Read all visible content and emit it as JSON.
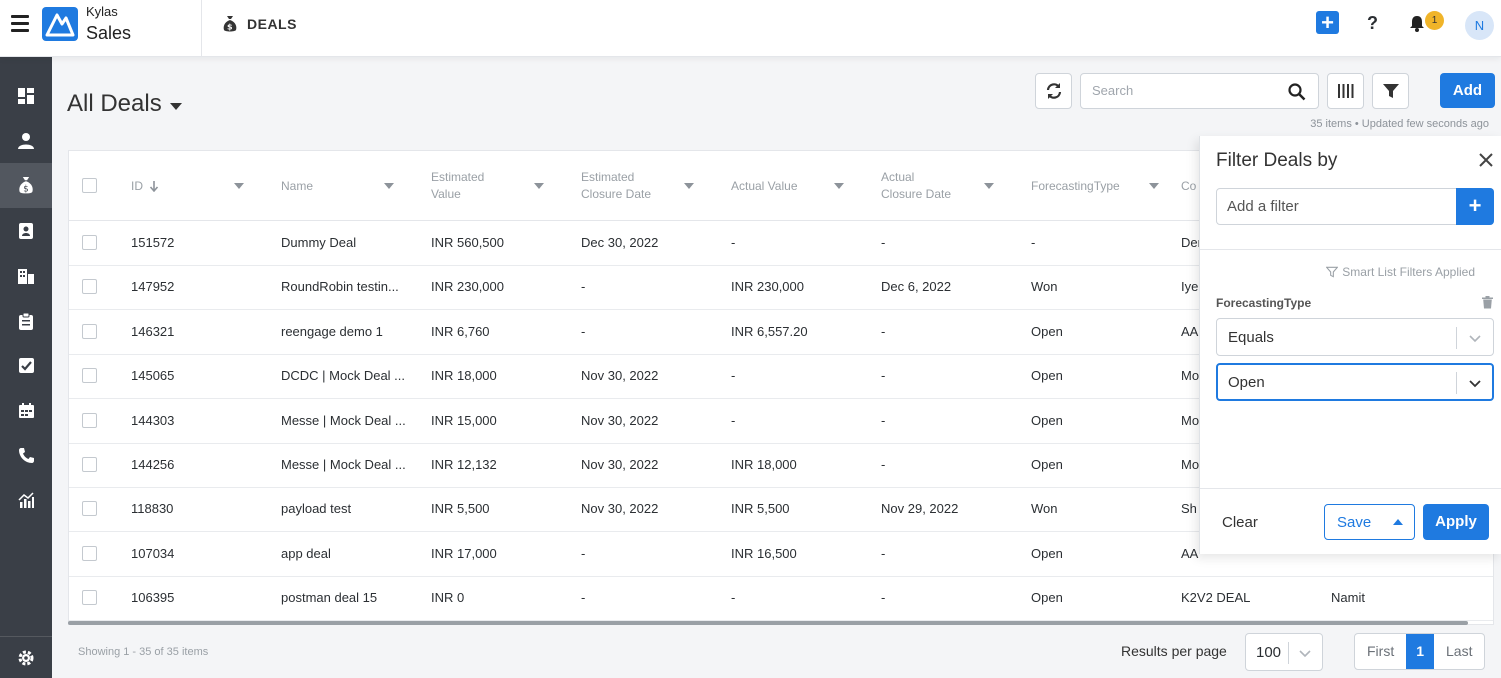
{
  "app": {
    "brand_top": "Kylas",
    "brand_main": "Sales",
    "module": "DEALS",
    "notification_count": "1",
    "avatar_initial": "N"
  },
  "colors": {
    "primary": "#1f7ae0",
    "sidebar": "#3a3f47",
    "badge": "#f0b429"
  },
  "sidebar": {
    "items": [
      {
        "icon": "dashboard-icon"
      },
      {
        "icon": "contact-icon"
      },
      {
        "icon": "money-bag-icon",
        "active": true
      },
      {
        "icon": "address-book-icon"
      },
      {
        "icon": "company-icon"
      },
      {
        "icon": "clipboard-icon"
      },
      {
        "icon": "task-check-icon"
      },
      {
        "icon": "calendar-icon"
      },
      {
        "icon": "phone-icon"
      },
      {
        "icon": "reports-icon"
      }
    ],
    "bottom_icon": "gear-icon"
  },
  "header": {
    "view_title": "All Deals",
    "search_placeholder": "Search",
    "add_label": "Add",
    "meta": "35 items • Updated few seconds ago"
  },
  "table": {
    "columns": [
      {
        "l1": "ID",
        "l2": ""
      },
      {
        "l1": "Name",
        "l2": ""
      },
      {
        "l1": "Estimated",
        "l2": "Value"
      },
      {
        "l1": "Estimated",
        "l2": "Closure Date"
      },
      {
        "l1": "Actual Value",
        "l2": ""
      },
      {
        "l1": "Actual",
        "l2": "Closure Date"
      },
      {
        "l1": "ForecastingType",
        "l2": ""
      },
      {
        "l1": "Co",
        "l2": ""
      }
    ],
    "rows": [
      [
        "151572",
        "Dummy Deal",
        "INR 560,500",
        "Dec 30, 2022",
        "-",
        "-",
        "-",
        "Der",
        ""
      ],
      [
        "147952",
        "RoundRobin testin...",
        "INR 230,000",
        "-",
        "INR 230,000",
        "Dec 6, 2022",
        "Won",
        "Iye",
        ""
      ],
      [
        "146321",
        "reengage demo 1",
        "INR 6,760",
        "-",
        "INR 6,557.20",
        "-",
        "Open",
        "AA",
        ""
      ],
      [
        "145065",
        "DCDC | Mock Deal ...",
        "INR 18,000",
        "Nov 30, 2022",
        "-",
        "-",
        "Open",
        "Mo",
        ""
      ],
      [
        "144303",
        "Messe | Mock Deal ...",
        "INR 15,000",
        "Nov 30, 2022",
        "-",
        "-",
        "Open",
        "Mo",
        ""
      ],
      [
        "144256",
        "Messe | Mock Deal ...",
        "INR 12,132",
        "Nov 30, 2022",
        "INR 18,000",
        "-",
        "Open",
        "Mo",
        ""
      ],
      [
        "118830",
        "payload test",
        "INR 5,500",
        "Nov 30, 2022",
        "INR 5,500",
        "Nov 29, 2022",
        "Won",
        "Sh",
        ""
      ],
      [
        "107034",
        "app deal",
        "INR 17,000",
        "-",
        "INR 16,500",
        "-",
        "Open",
        "AA",
        ""
      ],
      [
        "106395",
        "postman deal 15",
        "INR 0",
        "-",
        "-",
        "-",
        "Open",
        "K2V2 DEAL",
        "Namit"
      ]
    ]
  },
  "footer": {
    "showing": "Showing 1 - 35 of 35 items",
    "results_per_page_label": "Results per page",
    "results_per_page_value": "100",
    "pager": {
      "first": "First",
      "current": "1",
      "last": "Last"
    }
  },
  "filter_panel": {
    "title": "Filter Deals by",
    "add_filter_placeholder": "Add a filter",
    "smart_list_note": "Smart List Filters Applied",
    "field_label": "ForecastingType",
    "operator": "Equals",
    "value": "Open",
    "clear_label": "Clear",
    "save_label": "Save",
    "apply_label": "Apply"
  }
}
